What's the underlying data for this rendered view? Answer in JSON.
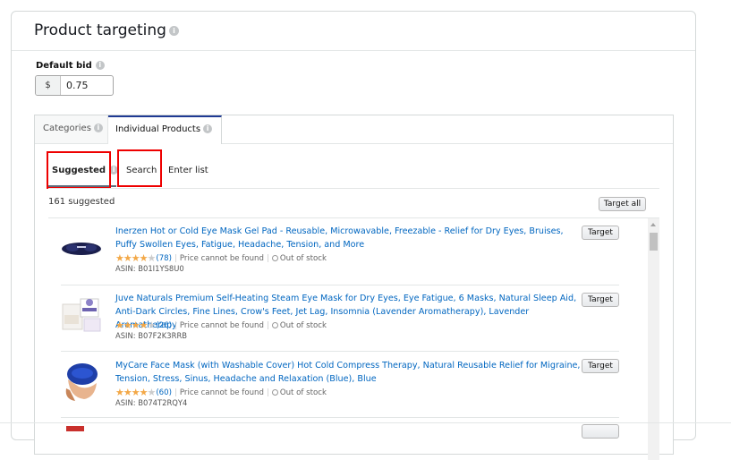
{
  "header": {
    "title": "Product targeting"
  },
  "bid": {
    "label": "Default bid",
    "currency": "$",
    "value": "0.75"
  },
  "tabs": [
    {
      "label": "Categories",
      "active": false
    },
    {
      "label": "Individual Products",
      "active": true
    }
  ],
  "subtabs": [
    {
      "label": "Suggested",
      "active": true
    },
    {
      "label": "Search",
      "active": false
    },
    {
      "label": "Enter list",
      "active": false
    }
  ],
  "count_label": "161 suggested",
  "target_all_label": "Target all",
  "colors": {
    "link": "#0066c0",
    "star": "#f3a847",
    "highlight": "#e00000",
    "active_tab_border": "#1f3a93"
  },
  "products": [
    {
      "title": "Inerzen Hot or Cold Eye Mask Gel Pad - Reusable, Microwavable, Freezable - Relief for Dry Eyes, Bruises, Puffy Swollen Eyes, Fatigue, Headache, Tension, and More",
      "rating": 3.5,
      "reviews": "(78)",
      "price": "Price cannot be found",
      "stock": "Out of stock",
      "asin": "ASIN: B01I1YS8U0",
      "button": "Target"
    },
    {
      "title": "Juve Naturals Premium Self-Heating Steam Eye Mask for Dry Eyes, Eye Fatigue, 6 Masks, Natural Sleep Aid, Anti-Dark Circles, Fine Lines, Crow's Feet, Jet Lag, Insomnia (Lavender Aromatherapy), Lavender Aromatherapy",
      "rating": 4,
      "reviews": "(26)",
      "price": "Price cannot be found",
      "stock": "Out of stock",
      "asin": "ASIN: B07F2K3RRB",
      "button": "Target"
    },
    {
      "title": "MyCare Face Mask (with Washable Cover) Hot Cold Compress Therapy, Natural Reusable Relief for Migraine, Tension, Stress, Sinus, Headache and Relaxation (Blue), Blue",
      "rating": 4,
      "reviews": "(60)",
      "price": "Price cannot be found",
      "stock": "Out of stock",
      "asin": "ASIN: B074T2RQY4",
      "button": "Target"
    }
  ]
}
